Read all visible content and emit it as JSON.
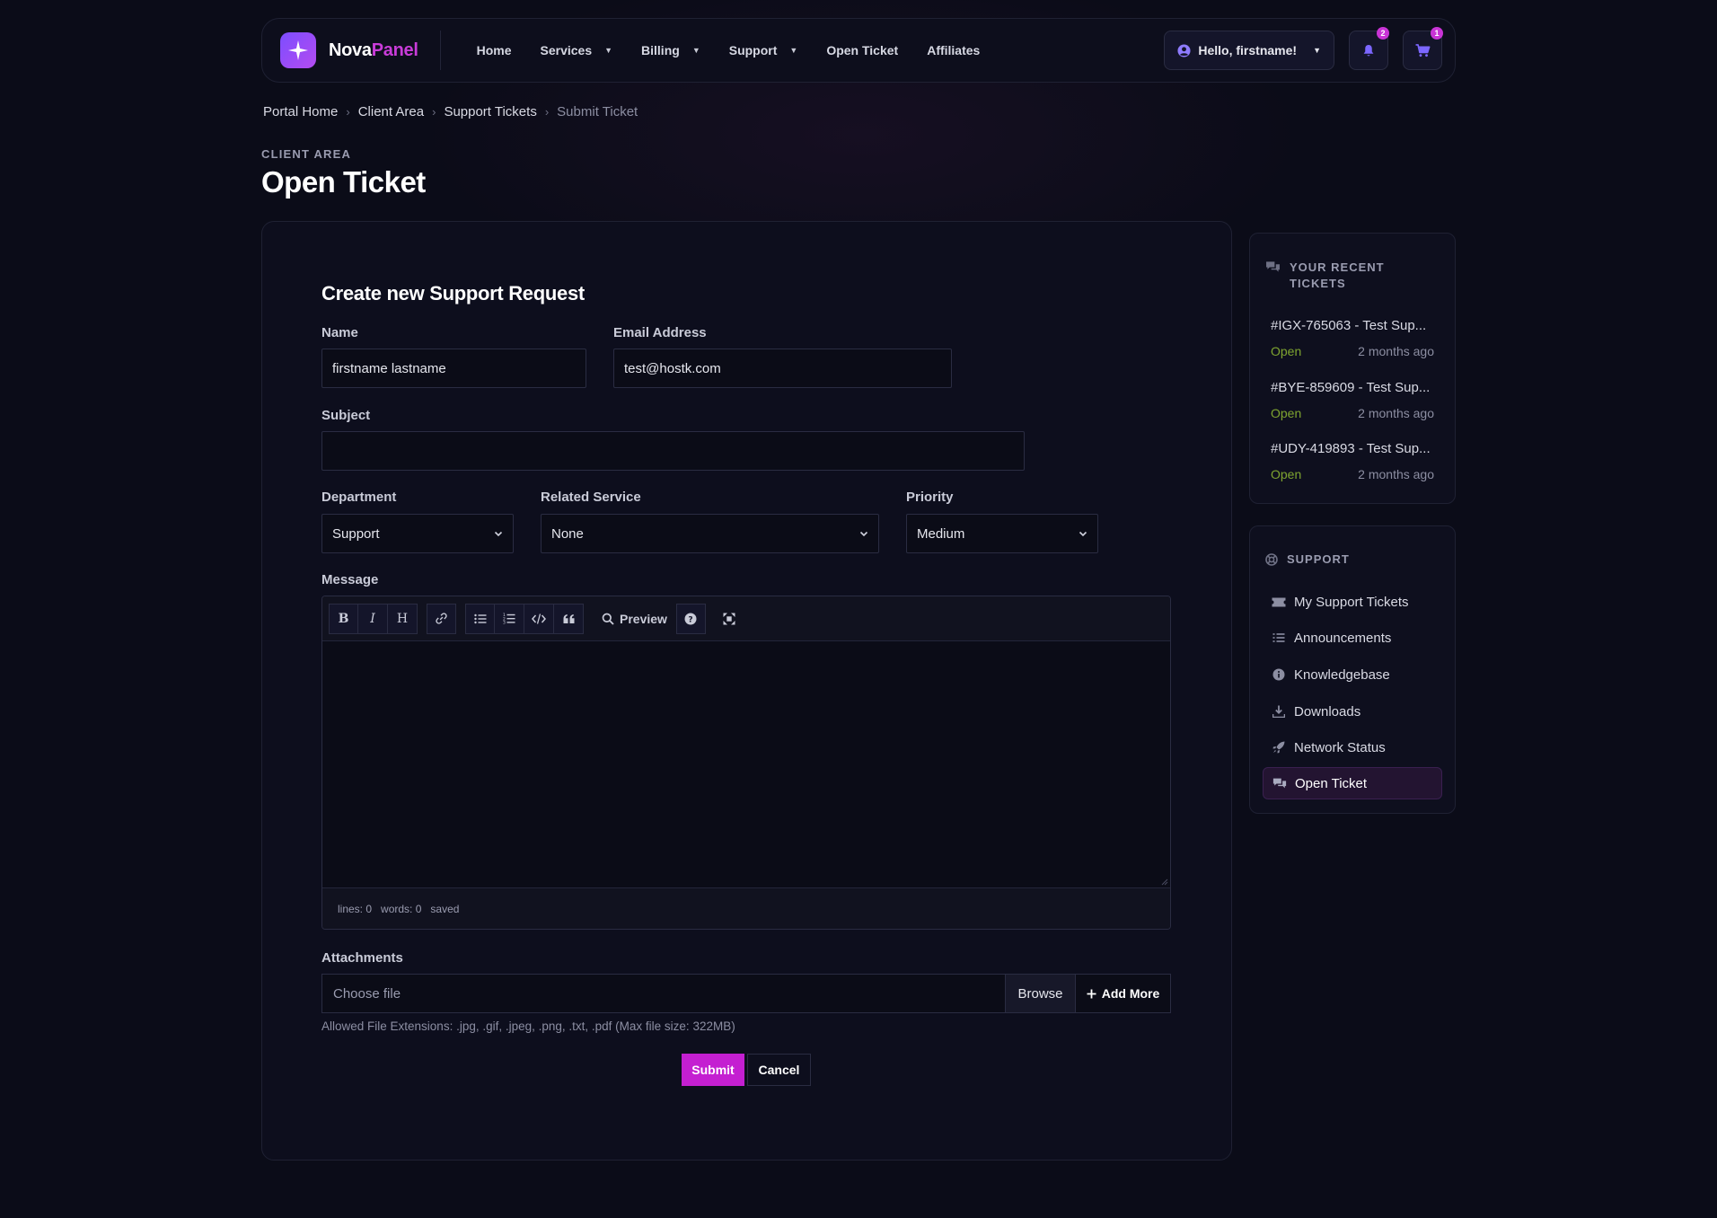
{
  "header": {
    "brand_main": "Nova",
    "brand_accent": "Panel",
    "nav": [
      {
        "label": "Home",
        "dropdown": false
      },
      {
        "label": "Services",
        "dropdown": true
      },
      {
        "label": "Billing",
        "dropdown": true
      },
      {
        "label": "Support",
        "dropdown": true
      },
      {
        "label": "Open Ticket",
        "dropdown": false
      },
      {
        "label": "Affiliates",
        "dropdown": false
      }
    ],
    "user_greeting": "Hello, firstname!",
    "notifications_count": "2",
    "cart_count": "1"
  },
  "breadcrumb": [
    "Portal Home",
    "Client Area",
    "Support Tickets",
    "Submit Ticket"
  ],
  "page": {
    "eyebrow": "CLIENT AREA",
    "title": "Open Ticket"
  },
  "form": {
    "title": "Create new Support Request",
    "name_label": "Name",
    "name_value": "firstname lastname",
    "email_label": "Email Address",
    "email_value": "test@hostk.com",
    "subject_label": "Subject",
    "subject_value": "",
    "department_label": "Department",
    "department_value": "Support",
    "related_label": "Related Service",
    "related_value": "None",
    "priority_label": "Priority",
    "priority_value": "Medium",
    "message_label": "Message",
    "preview_label": "Preview",
    "status_lines": "lines: 0",
    "status_words": "words: 0",
    "status_saved": "saved",
    "attachments_label": "Attachments",
    "attach_placeholder": "Choose file",
    "browse_label": "Browse",
    "add_more_label": "Add More",
    "help_text": "Allowed File Extensions: .jpg, .gif, .jpeg, .png, .txt, .pdf (Max file size: 322MB)",
    "submit_label": "Submit",
    "cancel_label": "Cancel"
  },
  "recent": {
    "heading_line1": "YOUR RECENT",
    "heading_line2": "TICKETS",
    "tickets": [
      {
        "title": "#IGX-765063 - Test Sup...",
        "status": "Open",
        "time": "2 months ago"
      },
      {
        "title": "#BYE-859609 - Test Sup...",
        "status": "Open",
        "time": "2 months ago"
      },
      {
        "title": "#UDY-419893 - Test Sup...",
        "status": "Open",
        "time": "2 months ago"
      }
    ],
    "status_color": "#7fa530"
  },
  "support": {
    "heading": "SUPPORT",
    "links": [
      {
        "label": "My Support Tickets",
        "icon": "ticket-icon"
      },
      {
        "label": "Announcements",
        "icon": "list-icon"
      },
      {
        "label": "Knowledgebase",
        "icon": "info-icon"
      },
      {
        "label": "Downloads",
        "icon": "download-icon"
      },
      {
        "label": "Network Status",
        "icon": "rocket-icon"
      },
      {
        "label": "Open Ticket",
        "icon": "comments-icon",
        "active": true
      }
    ]
  },
  "colors": {
    "accent": "#c41fd1",
    "brand_gradient_start": "#7c4dff",
    "brand_gradient_end": "#b44cf0"
  }
}
